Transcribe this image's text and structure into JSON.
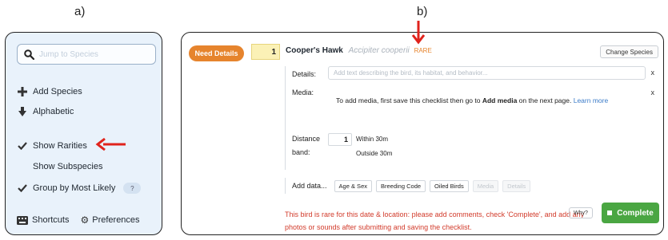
{
  "labels": {
    "a": "a)",
    "b": "b)"
  },
  "panel_a": {
    "search": {
      "placeholder": "Jump to Species",
      "icon": "search-icon"
    },
    "items": [
      {
        "label": "Add Species",
        "icon": "plus-icon"
      },
      {
        "label": "Alphabetic",
        "icon": "arrow-down-icon"
      },
      {
        "label": "Show Rarities",
        "icon": "check-icon"
      },
      {
        "label": "Show Subspecies",
        "icon": ""
      },
      {
        "label": "Group by Most Likely",
        "icon": "check-icon",
        "help": "?"
      }
    ],
    "shortcuts_label": "Shortcuts",
    "preferences_label": "Preferences"
  },
  "panel_b": {
    "need_details": "Need Details",
    "count": "1",
    "species_common": "Cooper's Hawk",
    "species_scientific": "Accipiter cooperii",
    "rare_tag": "RARE",
    "change_species": "Change Species",
    "details_label": "Details:",
    "details_placeholder": "Add text describing the bird, its habitat, and behavior...",
    "close": "x",
    "media_label": "Media:",
    "media_text_pre": "To add media, first save this checklist then go to ",
    "media_text_bold": "Add media",
    "media_text_post": " on the next page. ",
    "learn_more": "Learn more",
    "distance_label": "Distance band:",
    "distance_count": "1",
    "within": "Within 30m",
    "outside": "Outside 30m",
    "add_data_label": "Add data...",
    "data_buttons": [
      {
        "label": "Age & Sex",
        "enabled": true
      },
      {
        "label": "Breeding Code",
        "enabled": true
      },
      {
        "label": "Oiled Birds",
        "enabled": true
      },
      {
        "label": "Media",
        "enabled": false
      },
      {
        "label": "Details",
        "enabled": false
      }
    ],
    "rare_warning": "This bird is rare for this date & location: please add comments, check 'Complete', and add any photos or sounds after submitting and saving the checklist.",
    "why": "Why?",
    "complete": "Complete"
  },
  "colors": {
    "accent_orange": "#e6842d",
    "complete_green": "#4aa642",
    "warning_red": "#d23b2b",
    "arrow_red": "#e0231c",
    "panel_a_bg": "#e9f2fb"
  }
}
